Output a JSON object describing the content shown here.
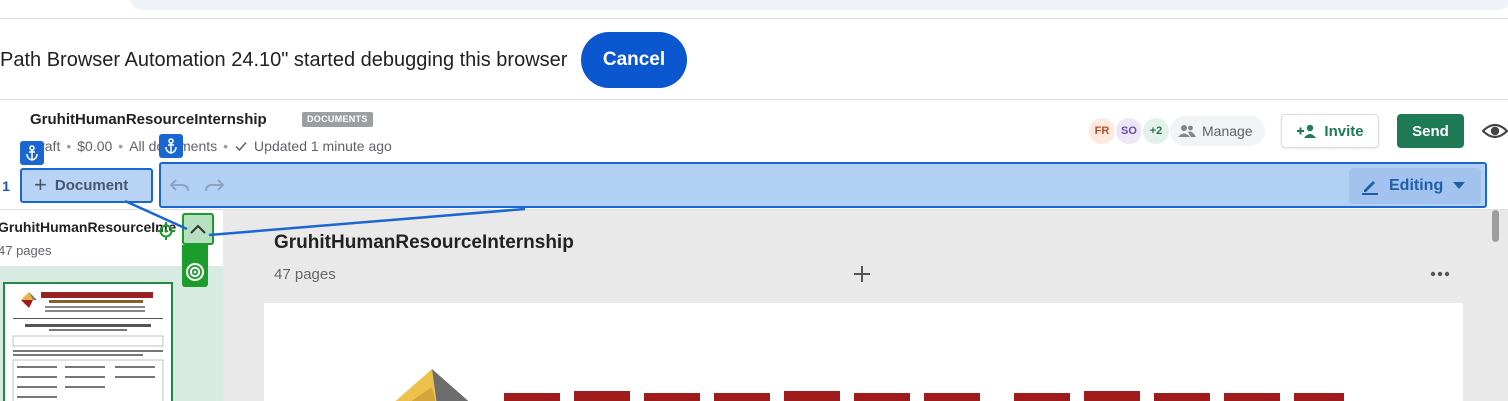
{
  "debug_bar": {
    "message": "Path Browser Automation 24.10\" started debugging this browser",
    "cancel_label": "Cancel"
  },
  "header": {
    "title": "GruhitHumanResourceInternship",
    "badge": "DOCUMENTS",
    "status": "Draft",
    "amount": "$0.00",
    "folder": "All documents",
    "updated": "Updated 1 minute ago",
    "avatars": [
      "FR",
      "SO",
      "+2"
    ],
    "manage_label": "Manage",
    "invite_label": "Invite",
    "send_label": "Send"
  },
  "toolbar": {
    "page_count_tab": "1",
    "document_button": "Document",
    "editing_label": "Editing"
  },
  "left_panel": {
    "title": "GruhitHumanResourceInternship",
    "subtitle": "47 pages"
  },
  "main": {
    "title": "GruhitHumanResourceInternship",
    "pages": "47 pages"
  },
  "colors": {
    "accent_blue": "#0b57d0",
    "send_green": "#1d7a55",
    "highlight_blue": "#1a67d2",
    "highlight_green": "#1b9c2b"
  }
}
